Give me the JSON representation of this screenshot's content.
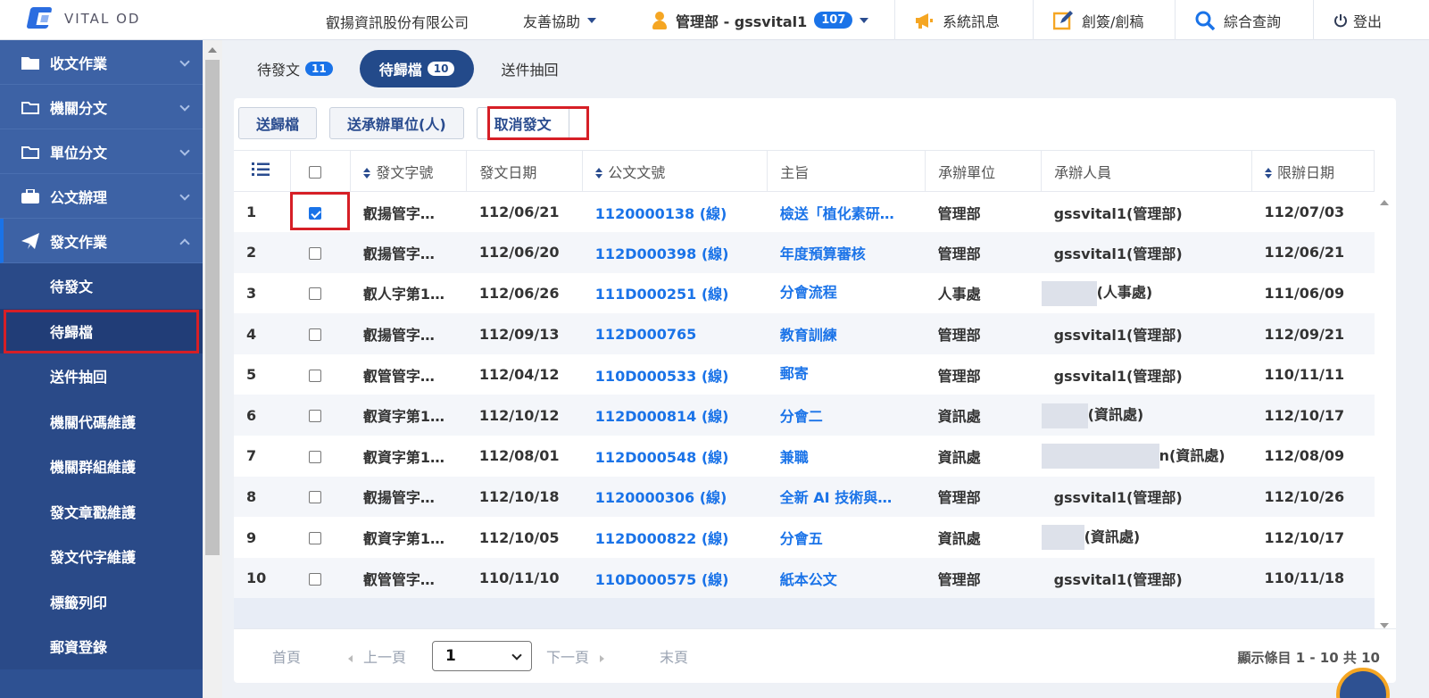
{
  "header": {
    "logo_text": "VITAL OD",
    "company": "叡揚資訊股份有限公司",
    "help": "友善協助",
    "user": "管理部 - gssvital1",
    "user_badge": "107",
    "messages": "系統訊息",
    "draft": "創簽/創稿",
    "search": "綜合查詢",
    "logout": "登出"
  },
  "sidebar": {
    "groups": [
      {
        "label": "收文作業"
      },
      {
        "label": "機關分文"
      },
      {
        "label": "單位分文"
      },
      {
        "label": "公文辦理"
      },
      {
        "label": "發文作業"
      }
    ],
    "subitems": [
      {
        "label": "待發文"
      },
      {
        "label": "待歸檔"
      },
      {
        "label": "送件抽回"
      },
      {
        "label": "機關代碼維護"
      },
      {
        "label": "機關群組維護"
      },
      {
        "label": "發文章戳維護"
      },
      {
        "label": "發文代字維護"
      },
      {
        "label": "標籤列印"
      },
      {
        "label": "郵資登錄"
      }
    ]
  },
  "tabs": [
    {
      "label": "待發文",
      "count": "11"
    },
    {
      "label": "待歸檔",
      "count": "10"
    },
    {
      "label": "送件抽回",
      "count": ""
    }
  ],
  "toolbar": {
    "archive": "送歸檔",
    "send_unit": "送承辦單位(人)",
    "cancel_send": "取消發文"
  },
  "table": {
    "headers": {
      "doc_word": "發文字號",
      "send_date": "發文日期",
      "doc_no": "公文文號",
      "subject": "主旨",
      "unit": "承辦單位",
      "person": "承辦人員",
      "deadline": "限辦日期"
    },
    "rows": [
      {
        "no": "1",
        "word": "叡揚管字…",
        "date": "112/06/21",
        "docno": "1120000138 (線)",
        "subject": "檢送「植化素研…",
        "unit": "管理部",
        "person": "gssvital1(管理部)",
        "deadline": "112/07/03"
      },
      {
        "no": "2",
        "word": "叡揚管字…",
        "date": "112/06/20",
        "docno": "112D000398 (線)",
        "subject": "年度預算審核",
        "unit": "管理部",
        "person": "gssvital1(管理部)",
        "deadline": "112/06/21"
      },
      {
        "no": "3",
        "word": "叡人字第1…",
        "date": "112/06/26",
        "docno": "111D000251 (線)",
        "subject": "分會流程",
        "unit": "人事處",
        "person": "(人事處)",
        "deadline": "111/06/09"
      },
      {
        "no": "4",
        "word": "叡揚管字…",
        "date": "112/09/13",
        "docno": "112D000765",
        "subject": "教育訓練",
        "unit": "管理部",
        "person": "gssvital1(管理部)",
        "deadline": "112/09/21"
      },
      {
        "no": "5",
        "word": "叡管管字…",
        "date": "112/04/12",
        "docno": "110D000533 (線)",
        "subject": "郵寄",
        "unit": "管理部",
        "person": "gssvital1(管理部)",
        "deadline": "110/11/11"
      },
      {
        "no": "6",
        "word": "叡資字第1…",
        "date": "112/10/12",
        "docno": "112D000814 (線)",
        "subject": "分會二",
        "unit": "資訊處",
        "person": "(資訊處)",
        "deadline": "112/10/17"
      },
      {
        "no": "7",
        "word": "叡資字第1…",
        "date": "112/08/01",
        "docno": "112D000548 (線)",
        "subject": "兼職",
        "unit": "資訊處",
        "person": "n(資訊處)",
        "deadline": "112/08/09"
      },
      {
        "no": "8",
        "word": "叡揚管字…",
        "date": "112/10/18",
        "docno": "1120000306 (線)",
        "subject": "全新 AI 技術與…",
        "unit": "管理部",
        "person": "gssvital1(管理部)",
        "deadline": "112/10/26"
      },
      {
        "no": "9",
        "word": "叡資字第1…",
        "date": "112/10/05",
        "docno": "112D000822 (線)",
        "subject": "分會五",
        "unit": "資訊處",
        "person": "(資訊處)",
        "deadline": "112/10/17"
      },
      {
        "no": "10",
        "word": "叡管管字…",
        "date": "110/11/10",
        "docno": "110D000575 (線)",
        "subject": "紙本公文",
        "unit": "管理部",
        "person": "gssvital1(管理部)",
        "deadline": "110/11/18"
      }
    ]
  },
  "pager": {
    "first": "首頁",
    "prev": "上一頁",
    "page": "1",
    "next": "下一頁",
    "last": "末頁",
    "summary": "顯示條目 1 - 10 共 10"
  },
  "colors": {
    "sidebar": "#2e5192",
    "accent": "#1a73e8",
    "highlight": "#d61f26"
  }
}
